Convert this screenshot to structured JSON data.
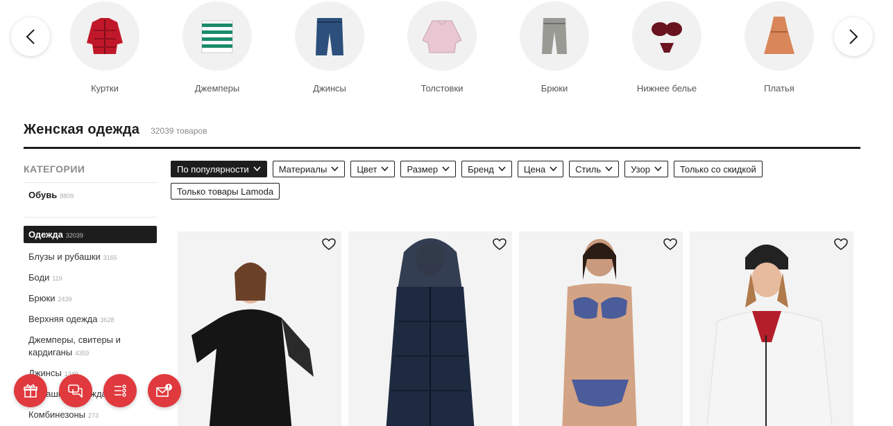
{
  "carousel": {
    "categories": [
      {
        "label": "Куртки",
        "icon": "jacket-icon",
        "color": "#c0182a"
      },
      {
        "label": "Джемперы",
        "icon": "sweater-icon",
        "color": "#1a8a6a"
      },
      {
        "label": "Джинсы",
        "icon": "jeans-icon",
        "color": "#2d4f7c"
      },
      {
        "label": "Толстовки",
        "icon": "hoodie-icon",
        "color": "#e8c6d2"
      },
      {
        "label": "Брюки",
        "icon": "trousers-icon",
        "color": "#9a9a94"
      },
      {
        "label": "Нижнее белье",
        "icon": "lingerie-icon",
        "color": "#6a1420"
      },
      {
        "label": "Платья",
        "icon": "dress-icon",
        "color": "#d9875a"
      }
    ]
  },
  "page": {
    "title": "Женская одежда",
    "count": "32039 товаров"
  },
  "sidebar": {
    "title": "КАТЕГОРИИ",
    "top": {
      "label": "Обувь",
      "count": "8809"
    },
    "active": {
      "label": "Одежда",
      "count": "32039"
    },
    "items": [
      {
        "label": "Блузы и рубашки",
        "count": "3165"
      },
      {
        "label": "Боди",
        "count": "119"
      },
      {
        "label": "Брюки",
        "count": "2439"
      },
      {
        "label": "Верхняя одежда",
        "count": "3628"
      },
      {
        "label": "Джемперы, свитеры и кардиганы",
        "count": "4359"
      },
      {
        "label": "Джинсы",
        "count": "1349"
      },
      {
        "label": "Домашняя одежда",
        "count": ""
      },
      {
        "label": "Комбинезоны",
        "count": "273"
      }
    ]
  },
  "filters": {
    "sort": "По популярности",
    "items": [
      "Материалы",
      "Цвет",
      "Размер",
      "Бренд",
      "Цена",
      "Стиль",
      "Узор"
    ],
    "toggles": [
      "Только со скидкой",
      "Только товары Lamoda"
    ]
  },
  "colors": {
    "accent": "#e03a3e",
    "dark": "#1d1d1d"
  }
}
